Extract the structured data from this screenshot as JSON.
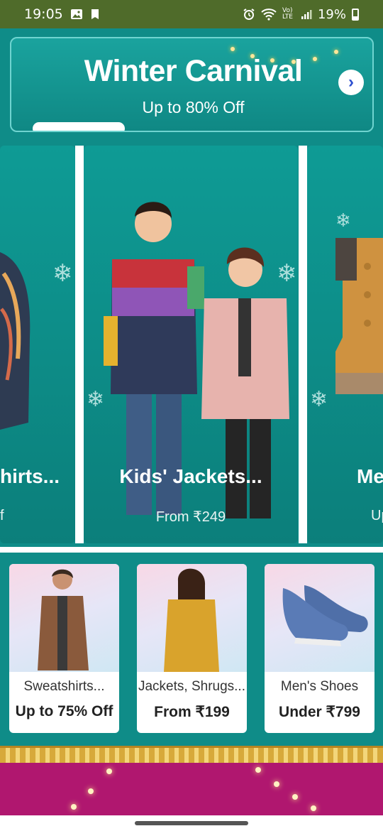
{
  "status_bar": {
    "time": "19:05",
    "battery": "19%",
    "network": "Vo) LTE"
  },
  "banner": {
    "title": "Winter Carnival",
    "subtitle": "Up to 80% Off",
    "arrow_icon": "chevron-right-icon"
  },
  "carousel": {
    "slides": [
      {
        "title": "hirts...",
        "price": "f"
      },
      {
        "title": "Kids' Jackets...",
        "price": "From ₹249"
      },
      {
        "title": "Me",
        "price": "Up"
      }
    ]
  },
  "cards": [
    {
      "name": "Sweatshirts...",
      "offer": "Up to 75% Off"
    },
    {
      "name": "Jackets, Shrugs...",
      "offer": "From ₹199"
    },
    {
      "name": "Men's Shoes",
      "offer": "Under ₹799"
    }
  ],
  "colors": {
    "status_bar": "#4f6b2a",
    "teal": "#0f8c88",
    "pink": "#b0176f",
    "accent_arrow": "#2d4fd0"
  }
}
